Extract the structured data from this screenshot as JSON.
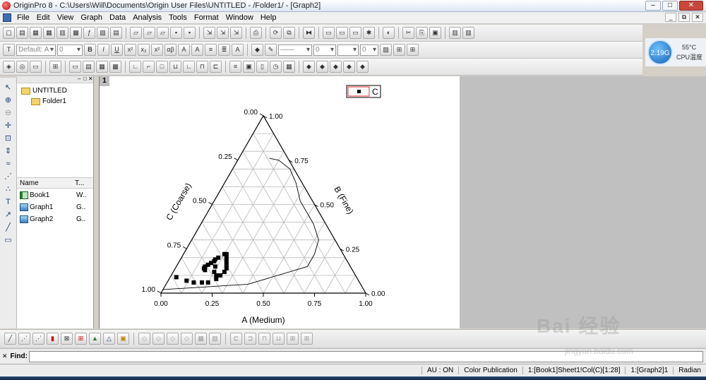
{
  "window": {
    "title": "OriginPro 8 - C:\\Users\\Will\\Documents\\Origin User Files\\UNTITLED - /Folder1/ - [Graph2]",
    "controls": [
      "–",
      "□",
      "✕"
    ],
    "mdi_controls": [
      "_",
      "⧉",
      "✕"
    ]
  },
  "menu": [
    "File",
    "Edit",
    "View",
    "Graph",
    "Data",
    "Analysis",
    "Tools",
    "Format",
    "Window",
    "Help"
  ],
  "format_toolbar": {
    "font": "Default: A",
    "size": "0",
    "line_width": "0",
    "border_width": "0"
  },
  "cpu_widget": {
    "memory": "2.19G",
    "temperature": "55°C",
    "label": "CPU温度"
  },
  "explorer": {
    "tree": [
      "UNTITLED",
      "Folder1"
    ],
    "columns": [
      "Name",
      "T..."
    ],
    "items": [
      {
        "name": "Book1",
        "type": "W..",
        "kind": "book"
      },
      {
        "name": "Graph1",
        "type": "G..",
        "kind": "graph"
      },
      {
        "name": "Graph2",
        "type": "G..",
        "kind": "graph"
      }
    ]
  },
  "graph": {
    "page_number": "1",
    "legend_label": "C"
  },
  "chart_data": {
    "type": "scatter",
    "subtype": "ternary",
    "axes": {
      "A": {
        "label": "A (Medium)",
        "range": [
          0,
          1
        ],
        "ticks": [
          "0.00",
          "0.25",
          "0.50",
          "0.75",
          "1.00"
        ]
      },
      "B": {
        "label": "B (Fine)",
        "range": [
          0,
          1
        ],
        "ticks": [
          "0.00",
          "0.25",
          "0.50",
          "0.75",
          "1.00"
        ]
      },
      "C": {
        "label": "C (Coarse)",
        "range": [
          0,
          1
        ],
        "ticks": [
          "0.00",
          "0.25",
          "0.50",
          "0.75",
          "1.00"
        ]
      }
    },
    "grid": true,
    "legend": {
      "position": "top-right",
      "entries": [
        "C"
      ]
    },
    "series": [
      {
        "name": "C",
        "marker": "square",
        "color": "#000000",
        "points": [
          {
            "a": 0.03,
            "b": 0.09,
            "c": 0.88
          },
          {
            "a": 0.09,
            "b": 0.07,
            "c": 0.84
          },
          {
            "a": 0.13,
            "b": 0.06,
            "c": 0.81
          },
          {
            "a": 0.17,
            "b": 0.06,
            "c": 0.77
          },
          {
            "a": 0.2,
            "b": 0.06,
            "c": 0.74
          },
          {
            "a": 0.23,
            "b": 0.08,
            "c": 0.69
          },
          {
            "a": 0.24,
            "b": 0.1,
            "c": 0.66
          },
          {
            "a": 0.25,
            "b": 0.12,
            "c": 0.63
          },
          {
            "a": 0.25,
            "b": 0.14,
            "c": 0.61
          },
          {
            "a": 0.24,
            "b": 0.16,
            "c": 0.6
          },
          {
            "a": 0.23,
            "b": 0.18,
            "c": 0.59
          },
          {
            "a": 0.22,
            "b": 0.2,
            "c": 0.58
          },
          {
            "a": 0.21,
            "b": 0.22,
            "c": 0.57
          },
          {
            "a": 0.2,
            "b": 0.22,
            "c": 0.58
          },
          {
            "a": 0.18,
            "b": 0.2,
            "c": 0.62
          },
          {
            "a": 0.17,
            "b": 0.19,
            "c": 0.64
          },
          {
            "a": 0.17,
            "b": 0.18,
            "c": 0.65
          },
          {
            "a": 0.16,
            "b": 0.17,
            "c": 0.67
          },
          {
            "a": 0.15,
            "b": 0.16,
            "c": 0.69
          },
          {
            "a": 0.14,
            "b": 0.15,
            "c": 0.71
          },
          {
            "a": 0.14,
            "b": 0.14,
            "c": 0.72
          },
          {
            "a": 0.15,
            "b": 0.13,
            "c": 0.72
          },
          {
            "a": 0.19,
            "b": 0.15,
            "c": 0.66
          },
          {
            "a": 0.2,
            "b": 0.12,
            "c": 0.68
          },
          {
            "a": 0.22,
            "b": 0.1,
            "c": 0.68
          }
        ]
      }
    ],
    "outline_line": {
      "color": "#000000",
      "points": [
        {
          "a": 0.0,
          "b": 0.02,
          "c": 0.98
        },
        {
          "a": 0.4,
          "b": 0.05,
          "c": 0.55
        },
        {
          "a": 0.64,
          "b": 0.15,
          "c": 0.21
        },
        {
          "a": 0.64,
          "b": 0.22,
          "c": 0.14
        },
        {
          "a": 0.62,
          "b": 0.3,
          "c": 0.08
        },
        {
          "a": 0.55,
          "b": 0.39,
          "c": 0.06
        },
        {
          "a": 0.42,
          "b": 0.52,
          "c": 0.06
        },
        {
          "a": 0.35,
          "b": 0.62,
          "c": 0.03
        },
        {
          "a": 0.28,
          "b": 0.7,
          "c": 0.02
        },
        {
          "a": 0.2,
          "b": 0.75,
          "c": 0.05
        },
        {
          "a": 0.15,
          "b": 0.76,
          "c": 0.09
        }
      ]
    }
  },
  "find_bar": {
    "label": "Find:",
    "value": ""
  },
  "status": {
    "au": "AU : ON",
    "theme": "Color Publication",
    "column": "1:[Book1]Sheet1!Col(C)[1:28]",
    "graph": "1:[Graph2]1",
    "angle": "Radian"
  },
  "watermark": {
    "brand": "Bai 经验",
    "url": "jingyan.baidu.com"
  }
}
